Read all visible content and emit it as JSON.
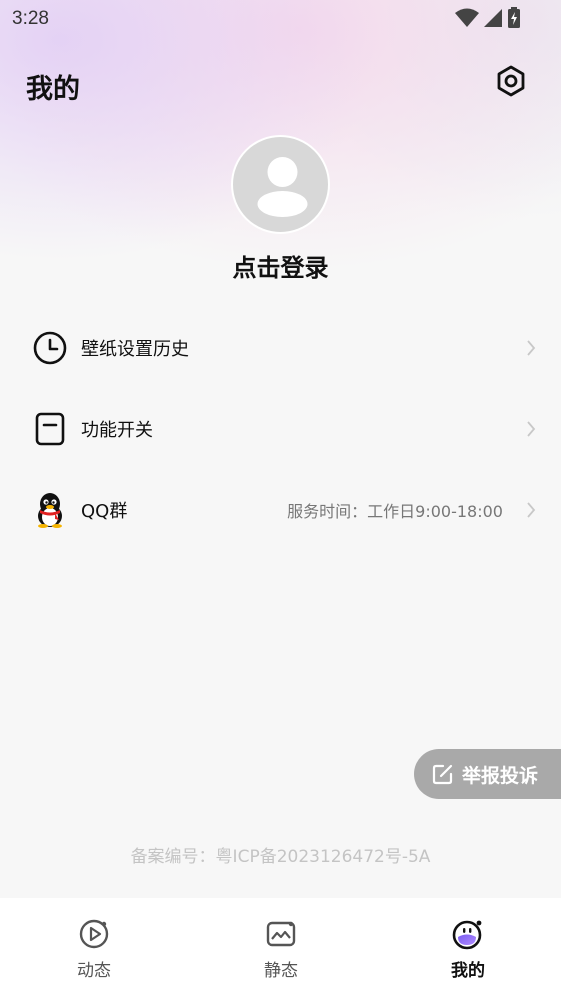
{
  "status_bar": {
    "time": "3:28"
  },
  "header": {
    "title": "我的"
  },
  "profile": {
    "login_text": "点击登录"
  },
  "menu": [
    {
      "label": "壁纸设置历史",
      "icon": "clock-icon",
      "right_text": ""
    },
    {
      "label": "功能开关",
      "icon": "switch-icon",
      "right_text": ""
    },
    {
      "label": "QQ群",
      "icon": "qq-penguin-icon",
      "right_text": "服务时间：工作日9:00-18:00"
    }
  ],
  "report": {
    "label": "举报投诉"
  },
  "footer": {
    "icp": "备案编号：粤ICP备2023126472号-5A"
  },
  "tabs": [
    {
      "label": "动态",
      "icon": "play-circle-icon",
      "active": false
    },
    {
      "label": "静态",
      "icon": "image-icon",
      "active": false
    },
    {
      "label": "我的",
      "icon": "profile-face-icon",
      "active": true
    }
  ],
  "colors": {
    "accent": "#8a6cf0",
    "report_bg": "#a9a9a9",
    "icp_text": "#c4c4c4"
  }
}
